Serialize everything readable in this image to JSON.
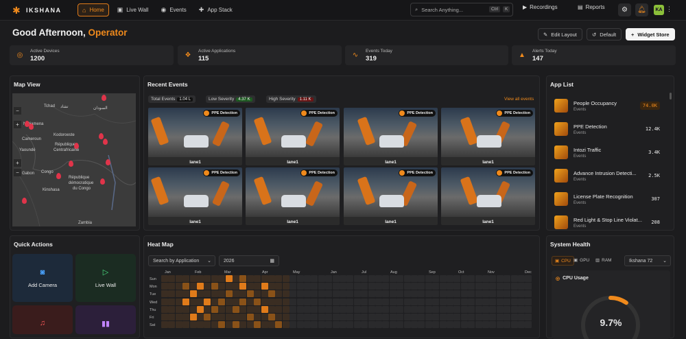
{
  "brand": {
    "name": "IKSHANA"
  },
  "nav": [
    {
      "label": "Home",
      "icon": "home-icon",
      "active": true
    },
    {
      "label": "Live Wall",
      "icon": "video-icon",
      "active": false
    },
    {
      "label": "Events",
      "icon": "eye-icon",
      "active": false
    },
    {
      "label": "App Stack",
      "icon": "puzzle-icon",
      "active": false
    }
  ],
  "search": {
    "placeholder": "Search Anything...",
    "kbd1": "Ctrl",
    "kbd2": "K"
  },
  "topright": {
    "recordings": "Recordings",
    "reports": "Reports",
    "avatar": "KA"
  },
  "greeting": {
    "text": "Good Afternoon,",
    "role": "Operator"
  },
  "header_buttons": {
    "edit": "Edit Layout",
    "default": "Default",
    "widget": "Widget Store"
  },
  "stats": [
    {
      "label": "Active Devices",
      "value": "1200",
      "icon": "camera-icon"
    },
    {
      "label": "Active Applications",
      "value": "115",
      "icon": "apps-icon"
    },
    {
      "label": "Events Today",
      "value": "319",
      "icon": "activity-icon"
    },
    {
      "label": "Alerts Today",
      "value": "147",
      "icon": "alert-icon"
    }
  ],
  "map": {
    "title": "Map View",
    "labels": [
      "Tchad",
      "تشاد",
      "السودان",
      "N'Djamena",
      "Cameroun",
      "Kodoroeste",
      "République",
      "Centrafricaine",
      "Yaoundé",
      "Gabon",
      "Congo",
      "République",
      "démocratique",
      "du Congo",
      "Kinshasa",
      "Zambia"
    ]
  },
  "recent_events": {
    "title": "Recent Events",
    "chips": [
      {
        "label": "Total Events",
        "count": "1.04 L",
        "color": "#111111"
      },
      {
        "label": "Low Severity",
        "count": "4.37 K",
        "color": "#1e5a22"
      },
      {
        "label": "High Severity",
        "count": "1.11 K",
        "color": "#6a1414"
      }
    ],
    "view_all": "View all events",
    "tag": "PPE Detection",
    "caption": "lane1"
  },
  "app_list": {
    "title": "App List",
    "items": [
      {
        "name": "People Occupancy",
        "sub": "Events",
        "count": "74.0K",
        "highlight": true
      },
      {
        "name": "PPE Detection",
        "sub": "Events",
        "count": "12.4K",
        "highlight": false
      },
      {
        "name": "Intozi Traffic",
        "sub": "Events",
        "count": "3.4K",
        "highlight": false
      },
      {
        "name": "Advance Intrusion Detecti...",
        "sub": "Events",
        "count": "2.5K",
        "highlight": false
      },
      {
        "name": "License Plate Recognition",
        "sub": "Events",
        "count": "307",
        "highlight": false
      },
      {
        "name": "Red Light & Stop Line Violat...",
        "sub": "Events",
        "count": "208",
        "highlight": false
      }
    ]
  },
  "quick_actions": {
    "title": "Quick Actions",
    "items": [
      {
        "label": "Add Camera",
        "icon": "camera-icon"
      },
      {
        "label": "Live Wall",
        "icon": "play-icon"
      }
    ]
  },
  "heatmap": {
    "title": "Heat Map",
    "search": "Search by Application",
    "year": "2026",
    "months": [
      "Jan",
      "Feb",
      "Mar",
      "Apr",
      "May",
      "Jan",
      "Jul",
      "Aug",
      "Sep",
      "Oct",
      "Nov",
      "Dec"
    ],
    "days": [
      "Sun",
      "Mon",
      "Tue",
      "Wed",
      "Thu",
      "Fri",
      "Sat"
    ]
  },
  "system_health": {
    "title": "System Health",
    "tabs": [
      "CPU",
      "GPU",
      "RAM"
    ],
    "device": "Ikshana 72",
    "cpu_title": "CPU Usage",
    "cpu_value": "9.7%",
    "cpu_fraction": 0.097,
    "accent": "#f08a1c"
  }
}
